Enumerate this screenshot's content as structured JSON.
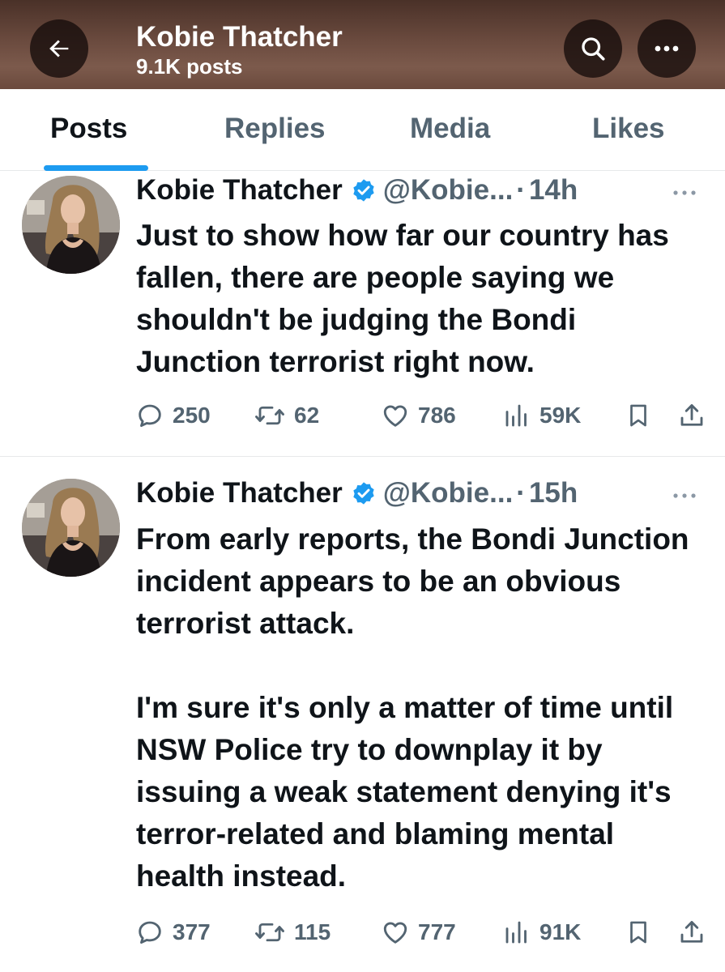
{
  "header": {
    "title": "Kobie Thatcher",
    "subtitle": "9.1K posts",
    "back_icon": "arrow-left-icon",
    "search_icon": "search-icon",
    "more_icon": "more-icon"
  },
  "tabs": [
    {
      "label": "Posts",
      "active": true
    },
    {
      "label": "Replies",
      "active": false
    },
    {
      "label": "Media",
      "active": false
    },
    {
      "label": "Likes",
      "active": false
    }
  ],
  "colors": {
    "accent": "#1d9bf0",
    "text_primary": "#0f1419",
    "text_secondary": "#536471"
  },
  "posts": [
    {
      "name": "Kobie Thatcher",
      "handle": "@Kobie...",
      "separator": "·",
      "time": "14h",
      "text": "Just to show how far our country has fallen, there are people saying we shouldn't be judging the Bondi Junction terrorist right now.",
      "replies": "250",
      "reposts": "62",
      "likes": "786",
      "views": "59K"
    },
    {
      "name": "Kobie Thatcher",
      "handle": "@Kobie...",
      "separator": "·",
      "time": "15h",
      "text": "From early reports, the Bondi Junction incident appears to be an obvious terrorist attack.\n\nI'm sure it's only a matter of time until NSW Police try to downplay it by issuing a weak statement denying it's terror-related and blaming mental health instead.",
      "replies": "377",
      "reposts": "115",
      "likes": "777",
      "views": "91K"
    }
  ]
}
